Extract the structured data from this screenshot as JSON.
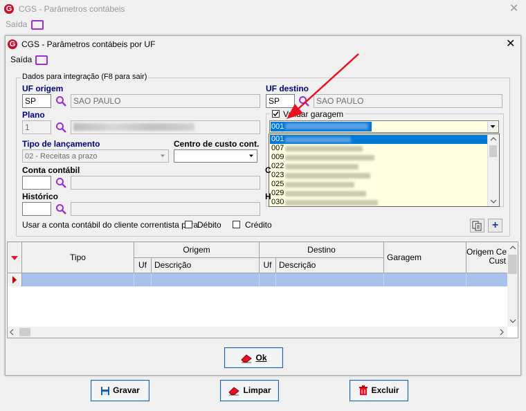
{
  "outer": {
    "title": "CGS - Parâmetros contábeis",
    "menu_saida": "Saída",
    "close": "✕"
  },
  "inner": {
    "title": "CGS - Parâmetros contábeis por UF",
    "menu_saida": "Saída",
    "close": "✕",
    "group_title": "Dados para integração  (F8 para sair)",
    "uf_origem": {
      "label": "UF origem",
      "value": "SP",
      "name": "SAO PAULO"
    },
    "uf_destino": {
      "label": "UF destino",
      "value": "SP",
      "name": "SAO PAULO"
    },
    "plano": {
      "label": "Plano",
      "value": "1"
    },
    "validar_garagem": {
      "label": "Validar garagem",
      "checked": true,
      "selected": "001"
    },
    "dropdown_items": [
      "001",
      "007",
      "009",
      "022",
      "023",
      "025",
      "029",
      "030"
    ],
    "tipo_lancamento": {
      "label": "Tipo de lançamento",
      "value": "02 - Receitas a prazo"
    },
    "centro_custo": {
      "label": "Centro de custo cont."
    },
    "conta_contabil": {
      "label": "Conta contábil",
      "right_label": "C"
    },
    "historico": {
      "label": "Histórico",
      "right_label": "H"
    },
    "usar_conta_text": "Usar a conta contábil do cliente correntista para",
    "debito": "Débito",
    "credito": "Crédito",
    "plus": "+"
  },
  "grid": {
    "col_tipo": "Tipo",
    "col_origem": "Origem",
    "col_destino": "Destino",
    "col_garagem": "Garagem",
    "col_origem_cc": "Origem Ce\nCust",
    "sub_uf": "Uf",
    "sub_descricao": "Descrição"
  },
  "buttons": {
    "ok": "Ok",
    "gravar": "Gravar",
    "limpar": "Limpar",
    "excluir": "Excluir"
  },
  "colors": {
    "label_blue": "#000080",
    "selection": "#0078d7",
    "dropdown_bg": "#ffffe1",
    "arrow_red": "#e81123"
  }
}
